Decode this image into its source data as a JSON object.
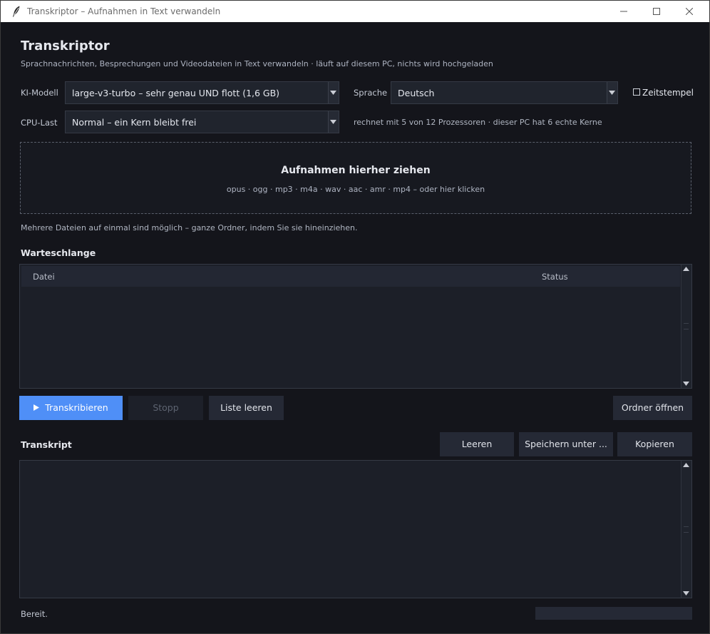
{
  "window": {
    "title": "Transkriptor  –  Aufnahmen in Text verwandeln"
  },
  "header": {
    "title": "Transkriptor",
    "subtitle": "Sprachnachrichten, Besprechungen und Videodateien in Text verwandeln  ·  läuft auf diesem PC, nichts wird hochgeladen"
  },
  "settings": {
    "model_label": "KI-Modell",
    "model_value": "large-v3-turbo  –  sehr genau UND flott  (1,6 GB)",
    "language_label": "Sprache",
    "language_value": "Deutsch",
    "timestamps_label": "Zeitstempel",
    "cpu_label": "CPU-Last",
    "cpu_value": "Normal  –  ein Kern bleibt frei",
    "cpu_info": "rechnet mit 5 von 12 Prozessoren  ·  dieser PC hat 6 echte Kerne"
  },
  "dropzone": {
    "title": "Aufnahmen hierher ziehen",
    "formats": "opus  ·  ogg  ·  mp3  ·  m4a  ·  wav  ·  aac  ·  amr  ·  mp4     –  oder hier klicken",
    "hint": "Mehrere Dateien auf einmal sind möglich – ganze Ordner, indem Sie sie hineinziehen."
  },
  "queue": {
    "title": "Warteschlange",
    "columns": [
      "Datei",
      "Status"
    ]
  },
  "actions": {
    "transcribe": "Transkribieren",
    "stop": "Stopp",
    "clear_list": "Liste leeren",
    "open_folder": "Ordner öffnen"
  },
  "transcript": {
    "title": "Transkript",
    "clear": "Leeren",
    "save_as": "Speichern unter ...",
    "copy": "Kopieren"
  },
  "status": {
    "text": "Bereit.",
    "progress": 0
  },
  "colors": {
    "accent": "#4f8ff7",
    "background": "#14151b",
    "panel": "#1c1f28"
  }
}
